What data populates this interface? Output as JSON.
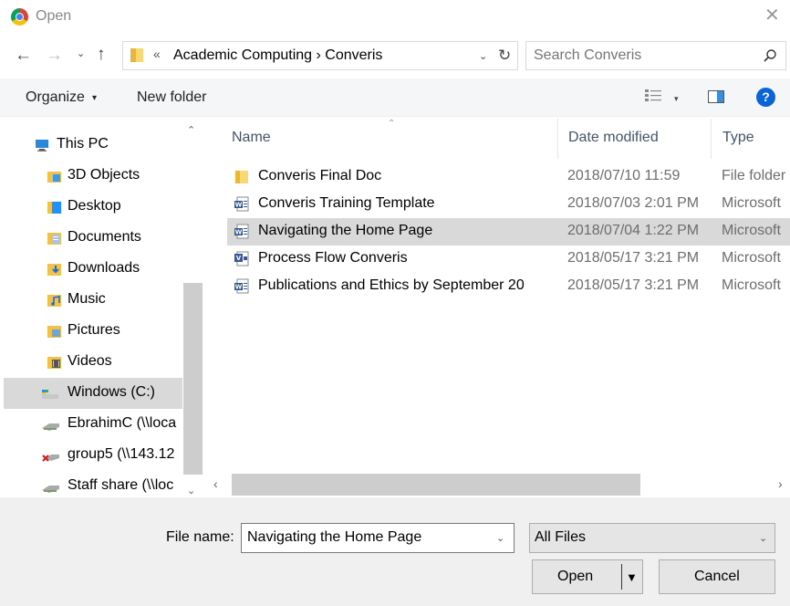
{
  "window": {
    "title": "Open",
    "close_glyph": "✕",
    "app_icon": "chrome-icon"
  },
  "address": {
    "prefix": "«",
    "path": "Academic Computing  ›  Converis",
    "dropdown_glyph": "⌄",
    "refresh_glyph": "↻"
  },
  "navigation": {
    "back_glyph": "←",
    "forward_glyph": "→",
    "recent_glyph": "⌄",
    "up_glyph": "↑"
  },
  "search": {
    "placeholder": "Search Converis"
  },
  "toolbar": {
    "organize_label": "Organize",
    "organize_caret": "▾",
    "new_folder_label": "New folder",
    "view_caret": "▾",
    "help_label": "?"
  },
  "nav_pane": {
    "items": [
      {
        "label": "This PC",
        "icon": "this-pc-icon",
        "color": "#2b88d8"
      },
      {
        "label": "3D Objects",
        "icon": "3d-objects-icon",
        "color": "#3d9be9"
      },
      {
        "label": "Desktop",
        "icon": "desktop-icon",
        "color": "#1e90ff"
      },
      {
        "label": "Documents",
        "icon": "documents-icon",
        "color": "#a3c4e8"
      },
      {
        "label": "Downloads",
        "icon": "downloads-icon",
        "color": "#1f6fcf"
      },
      {
        "label": "Music",
        "icon": "music-icon",
        "color": "#1f6fcf"
      },
      {
        "label": "Pictures",
        "icon": "pictures-icon",
        "color": "#6ea6d9"
      },
      {
        "label": "Videos",
        "icon": "videos-icon",
        "color": "#555555"
      },
      {
        "label": "Windows (C:)",
        "icon": "drive-icon",
        "color": "#49a64c",
        "selected": true
      },
      {
        "label": "EbrahimC (\\\\loca",
        "icon": "network-drive-icon",
        "color": "#7a9a6a"
      },
      {
        "label": "group5 (\\\\143.12",
        "icon": "disconnected-drive-icon",
        "color": "#d21f1f"
      },
      {
        "label": "Staff share (\\\\loc",
        "icon": "network-drive-icon",
        "color": "#7a9a6a"
      }
    ],
    "scroll_up_glyph": "⌃",
    "scroll_down_glyph": "⌄"
  },
  "file_list": {
    "sort_glyph": "⌃",
    "columns": {
      "name": "Name",
      "date": "Date modified",
      "type": "Type"
    },
    "rows": [
      {
        "name": "Converis Final Doc",
        "date": "2018/07/10 11:59",
        "type": "File folder",
        "icon": "folder-icon"
      },
      {
        "name": "Converis Training Template",
        "date": "2018/07/03 2:01 PM",
        "type": "Microsoft",
        "icon": "word-doc-icon"
      },
      {
        "name": "Navigating the Home Page",
        "date": "2018/07/04 1:22 PM",
        "type": "Microsoft",
        "icon": "word-doc-icon",
        "selected": true
      },
      {
        "name": "Process Flow Converis",
        "date": "2018/05/17 3:21 PM",
        "type": "Microsoft",
        "icon": "visio-doc-icon"
      },
      {
        "name": "Publications and Ethics by September 20",
        "date": "2018/05/17 3:21 PM",
        "type": "Microsoft",
        "icon": "word-doc-icon"
      }
    ],
    "hscroll_left_glyph": "‹",
    "hscroll_right_glyph": "›"
  },
  "footer": {
    "file_name_label": "File name:",
    "file_name_value": "Navigating the Home Page",
    "file_name_dropdown_glyph": "⌄",
    "file_type_value": "All Files",
    "file_type_dropdown_glyph": "⌄",
    "open_label": "Open",
    "open_split_glyph": "▼",
    "cancel_label": "Cancel"
  },
  "colors": {
    "accent": "#0a64d8",
    "selection": "#d9d9d9",
    "header_text": "#44546a",
    "secondary_text": "#6d6d6d"
  }
}
